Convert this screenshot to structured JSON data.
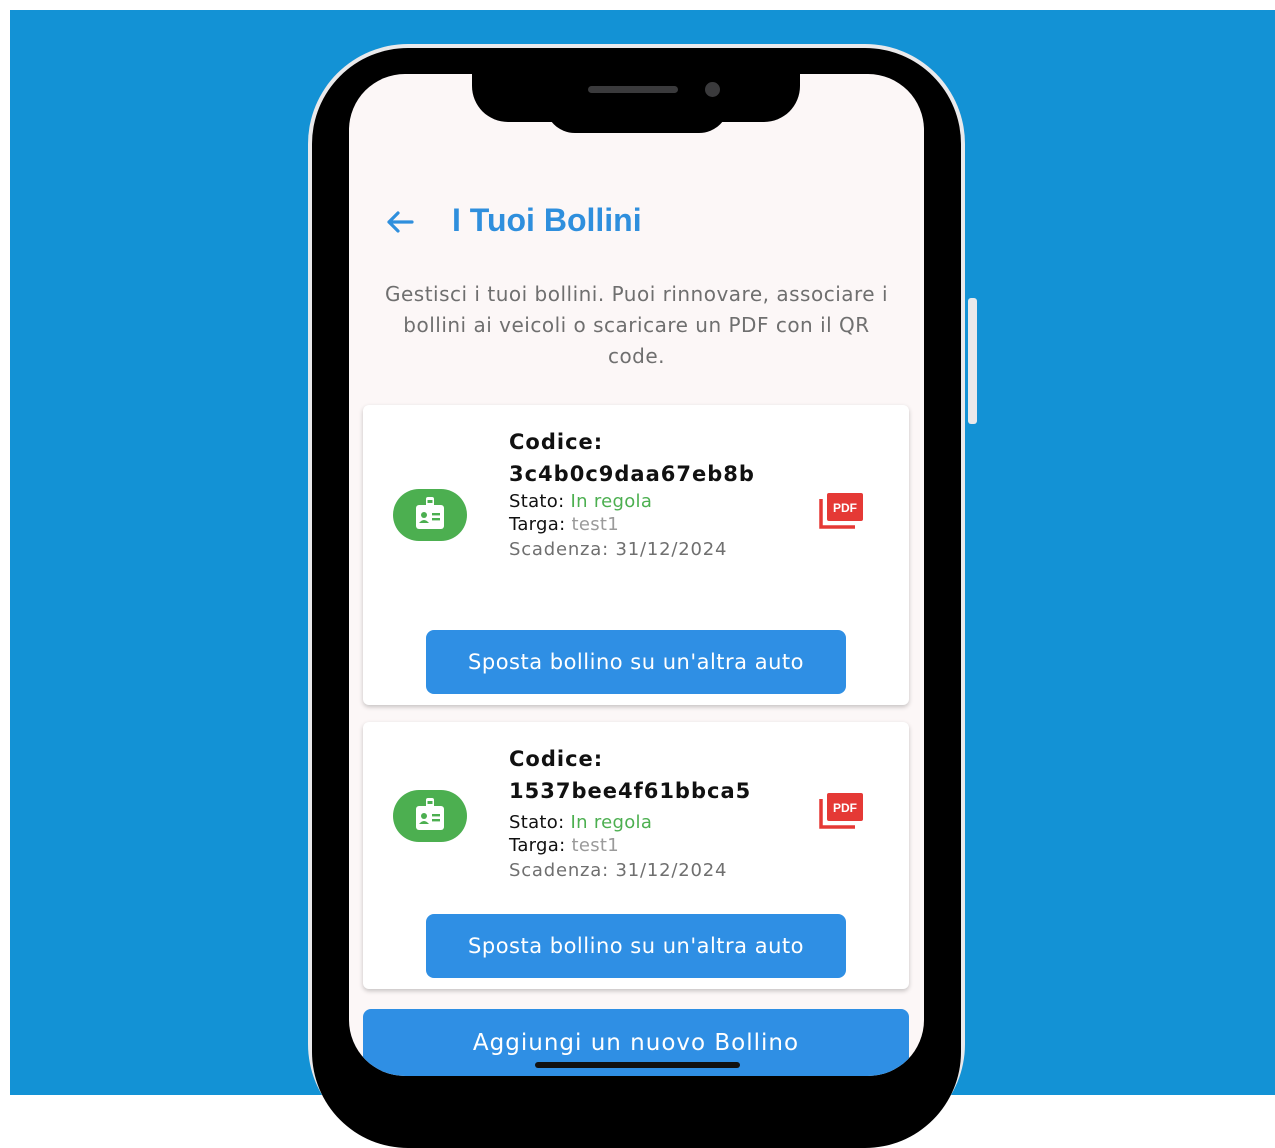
{
  "header": {
    "back_icon": "arrow-left-icon",
    "title": "I Tuoi Bollini"
  },
  "intro_text": "Gestisci i tuoi bollini. Puoi rinnovare, associare i bollini ai veicoli o scaricare un PDF con il QR code.",
  "colors": {
    "background": "#1392d5",
    "accent": "#2f8fe4",
    "title": "#2f8fdd",
    "status_ok": "#4caf50",
    "pdf": "#e53935"
  },
  "bollini": [
    {
      "code_label": "Codice:",
      "code": "3c4b0c9daa67eb8b",
      "status_label": "Stato:",
      "status": "In regola",
      "plate_label": "Targa:",
      "plate": "test1",
      "expiry": "Scadenza: 31/12/2024",
      "icon": "badge-icon",
      "pdf_icon": "pdf-icon",
      "action_label": "Sposta bollino su un'altra auto"
    },
    {
      "code_label": "Codice:",
      "code": "1537bee4f61bbca5",
      "status_label": "Stato:",
      "status": "In regola",
      "plate_label": "Targa:",
      "plate": "test1",
      "expiry": "Scadenza: 31/12/2024",
      "icon": "badge-icon",
      "pdf_icon": "pdf-icon",
      "action_label": "Sposta bollino su un'altra auto"
    }
  ],
  "add_button_label": "Aggiungi un nuovo Bollino"
}
